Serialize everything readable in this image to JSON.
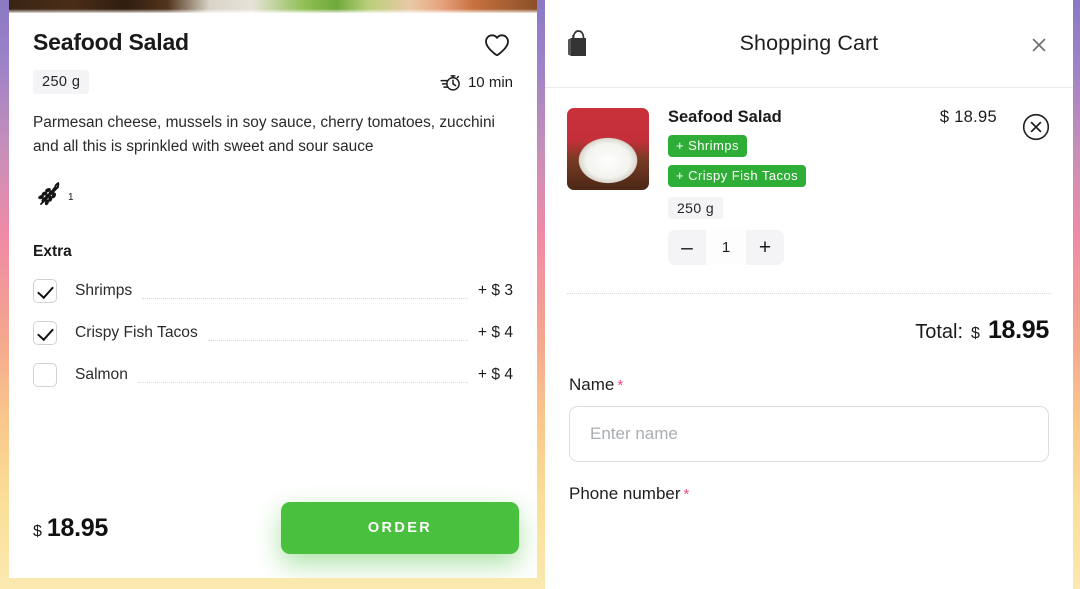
{
  "product": {
    "title": "Seafood Salad",
    "weight": "250 g",
    "cook_time": "10 min",
    "description": "Parmesan cheese, mussels in soy sauce, cherry tomatoes, zucchini and all this is sprinkled with sweet and sour sauce",
    "allergen_number": "1",
    "extra_heading": "Extra",
    "extras": [
      {
        "label": "Shrimps",
        "price": "+ $ 3",
        "checked": true
      },
      {
        "label": "Crispy Fish Tacos",
        "price": "+ $ 4",
        "checked": true
      },
      {
        "label": "Salmon",
        "price": "+ $ 4",
        "checked": false
      }
    ],
    "price_currency": "$",
    "price_value": "18.95",
    "order_label": "ORDER"
  },
  "cart": {
    "title": "Shopping Cart",
    "item": {
      "name": "Seafood Salad",
      "price": "$ 18.95",
      "addons": [
        "+ Shrimps",
        "+ Crispy Fish Tacos"
      ],
      "weight": "250 g",
      "quantity": "1",
      "decrease_label": "–",
      "increase_label": "+"
    },
    "total_label": "Total:",
    "total_currency": "$",
    "total_value": "18.95",
    "form": {
      "name_label": "Name",
      "name_required": "*",
      "name_placeholder": "Enter name",
      "name_value": "",
      "phone_label": "Phone number",
      "phone_required": "*"
    }
  },
  "colors": {
    "accent_green": "#4ac13e",
    "tag_green": "#2fae37",
    "required_pink": "#f0498a"
  }
}
